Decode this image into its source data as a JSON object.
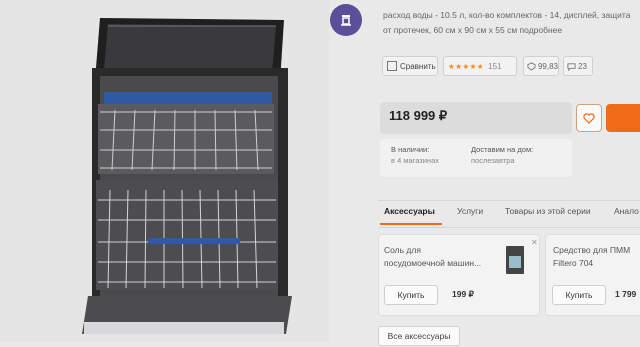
{
  "product": {
    "description": "расход воды - 10.5 л, кол-во комплектов - 14, дисплей, защита от протечек, 60 см x 90 см x 55 см подробнее",
    "compare_label": "Сравнить",
    "rating_count": "151",
    "rating_stars": "★★★★★",
    "reviews_score": "99,83",
    "comments_count": "23"
  },
  "price": {
    "value": "118 999 ₽"
  },
  "availability": {
    "stock_label": "В наличии:",
    "stock_value": "в 4 магазинах",
    "delivery_label": "Доставим на дом:",
    "delivery_value": "послезавтра"
  },
  "tabs": [
    "Аксессуары",
    "Услуги",
    "Товары из этой серии",
    "Анало"
  ],
  "accessories": [
    {
      "name_line1": "Соль для",
      "name_line2": "посудомоечной машин...",
      "buy_label": "Купить",
      "price": "199 ₽"
    },
    {
      "name_line1": "Средство для ПММ",
      "name_line2": "Filtero 704",
      "buy_label": "Купить",
      "price": "1 799"
    }
  ],
  "all_accessories_label": "Все аксессуары",
  "colors": {
    "accent": "#f06b15",
    "brand_icon": "#5a4f98",
    "stars": "#f08c1a"
  }
}
